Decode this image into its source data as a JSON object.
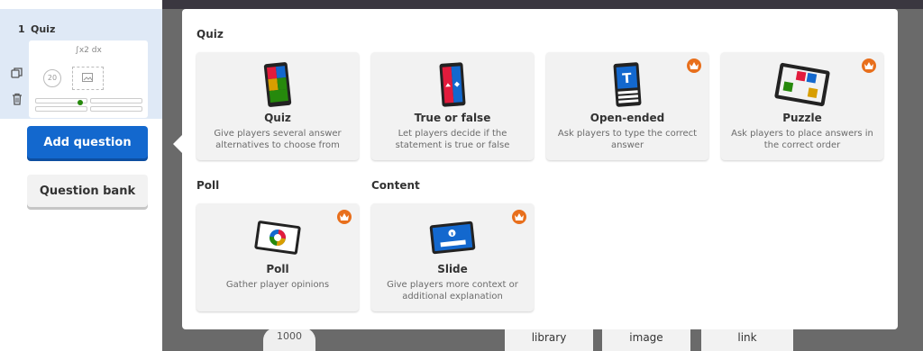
{
  "sidebar": {
    "slide_number": "1",
    "slide_title": "Quiz",
    "thumb_question": "∫x2 dx",
    "thumb_timer": "20",
    "add_question": "Add question",
    "question_bank": "Question bank"
  },
  "modal": {
    "sections": {
      "quiz": "Quiz",
      "poll": "Poll",
      "content": "Content"
    },
    "cards": [
      {
        "title": "Quiz",
        "desc": "Give players several answer alternatives to choose from",
        "premium": false,
        "icon": "quiz-icon"
      },
      {
        "title": "True or false",
        "desc": "Let players decide if the statement is true or false",
        "premium": false,
        "icon": "true-false-icon"
      },
      {
        "title": "Open-ended",
        "desc": "Ask players to type the correct answer",
        "premium": true,
        "icon": "open-ended-icon"
      },
      {
        "title": "Puzzle",
        "desc": "Ask players to place answers in the correct order",
        "premium": true,
        "icon": "puzzle-icon"
      },
      {
        "title": "Poll",
        "desc": "Gather player opinions",
        "premium": true,
        "icon": "poll-icon"
      },
      {
        "title": "Slide",
        "desc": "Give players more context or additional explanation",
        "premium": true,
        "icon": "slide-icon"
      }
    ]
  },
  "background": {
    "buttons": [
      "library",
      "image",
      "link"
    ],
    "points": "1000"
  },
  "colors": {
    "accent_blue": "#1368ce",
    "red": "#e21b3c",
    "blue": "#1368ce",
    "yellow": "#d89e00",
    "green": "#26890c",
    "premium_orange": "#e86f1c"
  }
}
